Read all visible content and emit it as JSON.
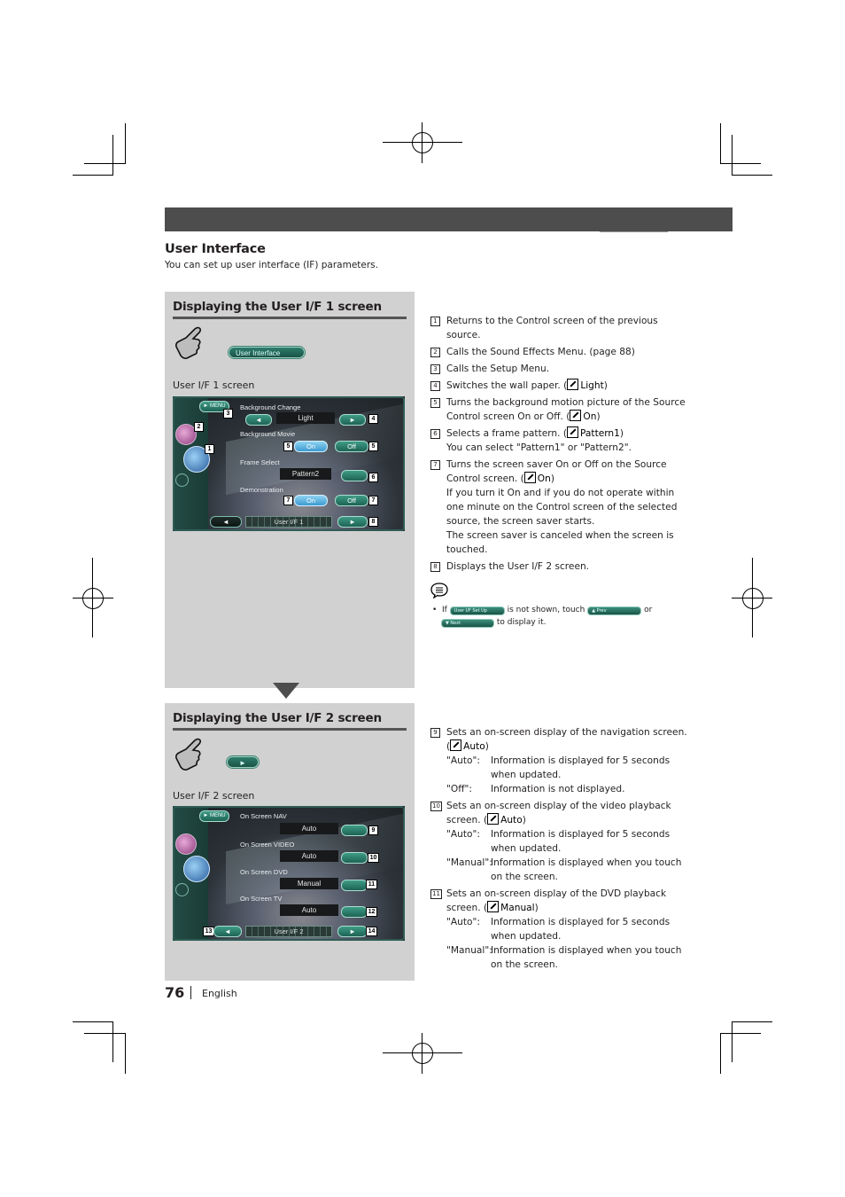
{
  "header": {
    "section_title": "User Interface",
    "section_subtitle": "You can set up user interface (IF) parameters."
  },
  "panel1": {
    "heading": "Displaying the User I/F 1 screen",
    "touch_button_label": "User Interface",
    "caption": "User I/F 1 screen",
    "screen": {
      "menu_label": "MENU",
      "rows": [
        {
          "label": "Background Change",
          "value": "Light"
        },
        {
          "label": "Background Movie",
          "on": "On",
          "off": "Off"
        },
        {
          "label": "Frame Select",
          "value": "Pattern2"
        },
        {
          "label": "Demonstration",
          "on": "On",
          "off": "Off"
        }
      ],
      "page_label": "User I/F 1",
      "prev_glyph": "◄",
      "next_glyph": "►",
      "callouts": [
        "1",
        "2",
        "3",
        "4",
        "5",
        "5",
        "6",
        "7",
        "7",
        "8"
      ]
    }
  },
  "panel2": {
    "heading": "Displaying the User I/F 2 screen",
    "touch_button_glyph": "►",
    "caption": "User I/F 2 screen",
    "screen": {
      "menu_label": "MENU",
      "rows": [
        {
          "label": "On Screen NAV",
          "value": "Auto"
        },
        {
          "label": "On Screen VIDEO",
          "value": "Auto"
        },
        {
          "label": "On Screen DVD",
          "value": "Manual"
        },
        {
          "label": "On Screen TV",
          "value": "Auto"
        }
      ],
      "page_label": "User I/F 2",
      "prev_glyph": "◄",
      "next_glyph": "►",
      "callouts": [
        "9",
        "10",
        "11",
        "12",
        "13",
        "14"
      ]
    }
  },
  "descriptions1": [
    {
      "n": "1",
      "text": "Returns to the Control screen of the previous source."
    },
    {
      "n": "2",
      "text": "Calls the Sound Effects Menu. (page 88)"
    },
    {
      "n": "3",
      "text": "Calls the Setup Menu."
    },
    {
      "n": "4",
      "text": "Switches the wall paper. (",
      "default": "Light",
      "tail": ")"
    },
    {
      "n": "5",
      "text": "Turns the background motion picture of the Source Control screen On or Off. (",
      "default": "On",
      "tail": ")"
    },
    {
      "n": "6",
      "text": "Selects a frame pattern. (",
      "default": "Pattern1",
      "tail": ")",
      "extra": "You can select \"Pattern1\" or \"Pattern2\"."
    },
    {
      "n": "7",
      "text": "Turns the screen saver On or Off on the Source Control screen. (",
      "default": "On",
      "tail": ")",
      "extra": "If you turn it On and if you do not operate within one minute on the Control screen of the selected source, the screen saver starts.",
      "extra2": "The screen saver is canceled when the screen is touched."
    },
    {
      "n": "8",
      "text": "Displays the User I/F 2 screen."
    }
  ],
  "note": {
    "prefix": "If",
    "pill1": "User I/F Set Up",
    "mid": "is not shown, touch",
    "pill2": "▲ Prev",
    "or": "or",
    "pill3": "▼ Next",
    "suffix": "to display it."
  },
  "descriptions2": [
    {
      "n": "9",
      "text": "Sets an on-screen display of the navigation screen. (",
      "default": "Auto",
      "tail": ")",
      "defs": [
        {
          "k": "\"Auto\":",
          "v": "Information is displayed for 5 seconds when updated."
        },
        {
          "k": "\"Off\":",
          "v": "Information is not displayed."
        }
      ]
    },
    {
      "n": "10",
      "text": "Sets an on-screen display of the video playback screen. (",
      "default": "Auto",
      "tail": ")",
      "defs": [
        {
          "k": "\"Auto\":",
          "v": "Information is displayed for 5 seconds when updated."
        },
        {
          "k": "\"Manual\":",
          "v": "Information is displayed when you touch on the screen."
        }
      ]
    },
    {
      "n": "11",
      "text": "Sets an on-screen display of the DVD playback screen. (",
      "default": "Manual",
      "tail": ")",
      "defs": [
        {
          "k": "\"Auto\":",
          "v": "Information is displayed for 5 seconds when updated."
        },
        {
          "k": "\"Manual\":",
          "v": "Information is displayed when you touch on the screen."
        }
      ]
    }
  ],
  "footer": {
    "page_number": "76",
    "language": "English"
  }
}
